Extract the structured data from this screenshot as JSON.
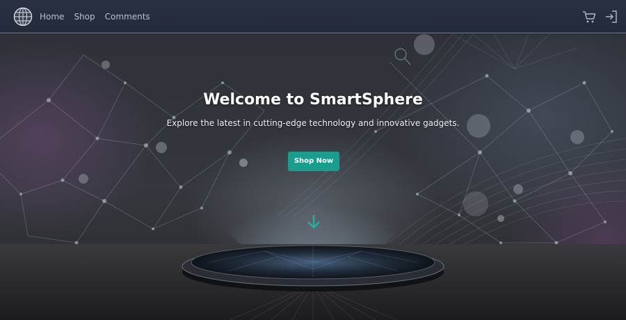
{
  "navbar": {
    "logo_icon": "globe-icon",
    "links": [
      {
        "label": "Home"
      },
      {
        "label": "Shop"
      },
      {
        "label": "Comments"
      }
    ],
    "right_icons": [
      "cart-icon",
      "login-icon"
    ]
  },
  "hero": {
    "title": "Welcome to SmartSphere",
    "subtitle": "Explore the latest in cutting-edge technology and innovative gadgets.",
    "cta_label": "Shop Now",
    "scroll_icon": "arrow-down-icon",
    "accent_color": "#1a9c8e"
  },
  "colors": {
    "navbar_bg": "#262d3d",
    "nav_link": "#b7c2d6",
    "button": "#1a9c8e",
    "arrow": "#1fb3a2"
  }
}
